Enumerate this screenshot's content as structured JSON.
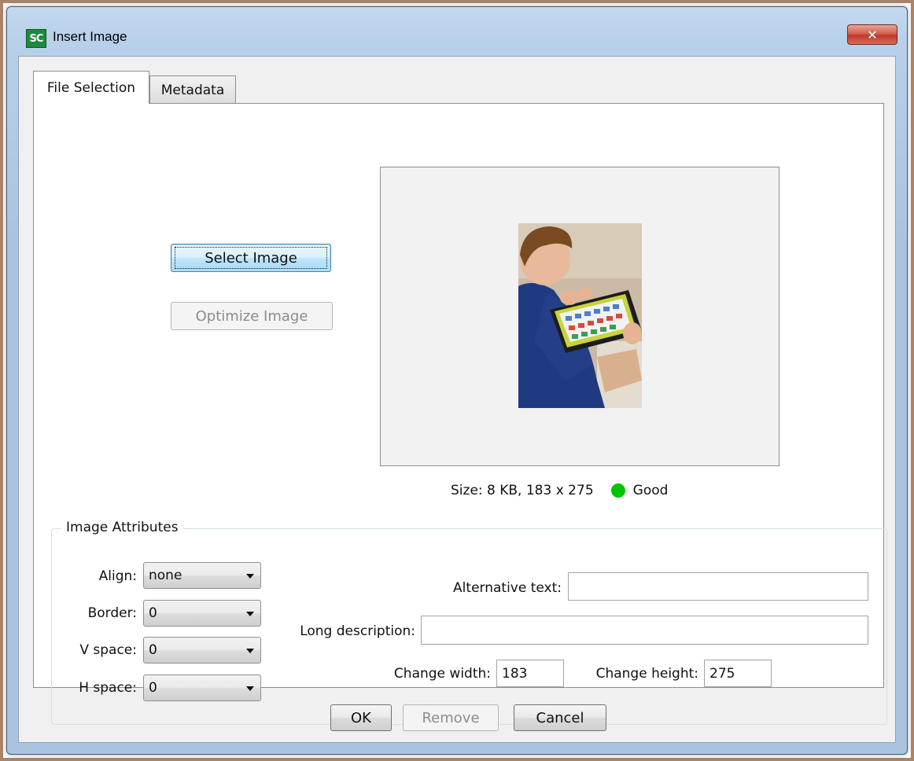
{
  "window": {
    "title": "Insert Image",
    "app_icon_text": "SC",
    "close_glyph": "✕"
  },
  "tabs": [
    {
      "label": "File Selection",
      "active": true
    },
    {
      "label": "Metadata",
      "active": false
    }
  ],
  "file_selection": {
    "select_image_label": "Select Image",
    "optimize_image_label": "Optimize Image",
    "size_text": "Size: 8 KB,  183 x 275",
    "quality_text": "Good",
    "quality_color": "#00c400"
  },
  "attributes": {
    "legend": "Image Attributes",
    "align": {
      "label": "Align:",
      "value": "none"
    },
    "border": {
      "label": "Border:",
      "value": "0"
    },
    "vspace": {
      "label": "V space:",
      "value": "0"
    },
    "hspace": {
      "label": "H space:",
      "value": "0"
    },
    "alt_text": {
      "label": "Alternative text:",
      "value": ""
    },
    "long_desc": {
      "label": "Long description:",
      "value": ""
    },
    "width": {
      "label": "Change width:",
      "value": "183"
    },
    "height": {
      "label": "Change height:",
      "value": "275"
    }
  },
  "footer": {
    "ok_label": "OK",
    "remove_label": "Remove",
    "cancel_label": "Cancel"
  }
}
